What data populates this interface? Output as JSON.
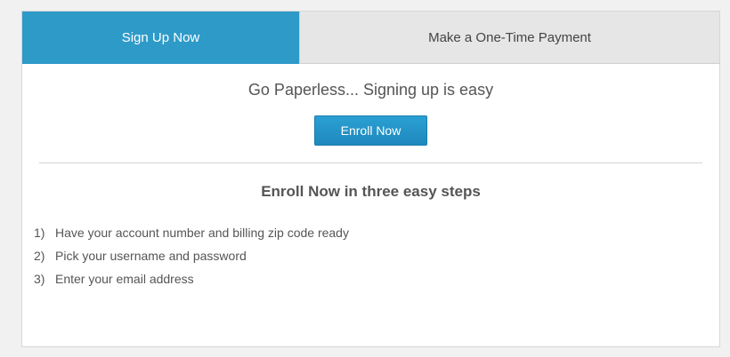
{
  "tabs": [
    {
      "label": "Sign Up Now",
      "active": true
    },
    {
      "label": "Make a One-Time Payment",
      "active": false
    }
  ],
  "headline": "Go Paperless... Signing up is easy",
  "enroll_button_label": "Enroll Now",
  "steps_title": "Enroll Now in three easy steps",
  "steps": [
    {
      "num": "1)",
      "text": "Have your account number and billing zip code ready"
    },
    {
      "num": "2)",
      "text": "Pick your username and password"
    },
    {
      "num": "3)",
      "text": "Enter your email address"
    }
  ],
  "colors": {
    "accent": "#2e9ac8",
    "inactive_tab": "#e6e6e6",
    "background": "#f1f1f1",
    "text": "#555555"
  }
}
